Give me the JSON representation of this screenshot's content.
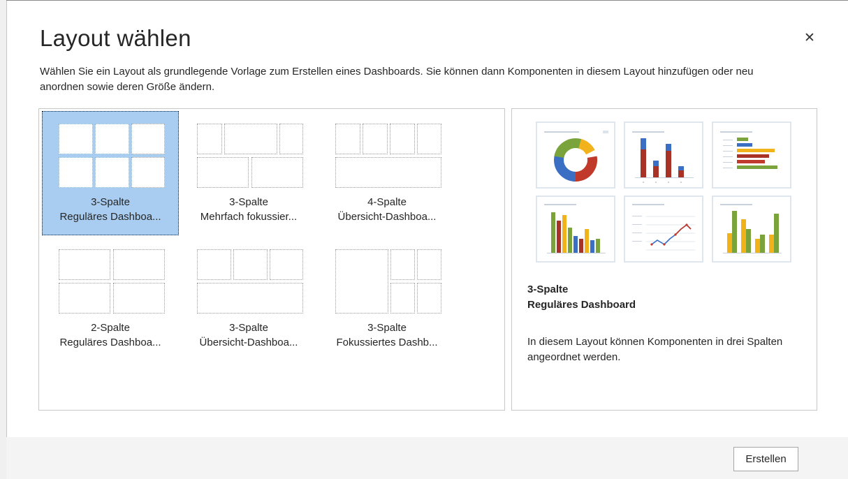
{
  "dialog": {
    "title": "Layout wählen",
    "close_glyph": "✕",
    "description": "Wählen Sie ein Layout als grundlegende Vorlage zum Erstellen eines Dashboards. Sie können dann Komponenten in diesem Layout hinzufügen oder neu anordnen sowie deren Größe ändern."
  },
  "layouts": [
    {
      "line1": "3-Spalte",
      "line2": "Reguläres Dashboa...",
      "selected": true
    },
    {
      "line1": "3-Spalte",
      "line2": "Mehrfach fokussier...",
      "selected": false
    },
    {
      "line1": "4-Spalte",
      "line2": "Übersicht-Dashboa...",
      "selected": false
    },
    {
      "line1": "2-Spalte",
      "line2": "Reguläres Dashboa...",
      "selected": false
    },
    {
      "line1": "3-Spalte",
      "line2": "Übersicht-Dashboa...",
      "selected": false
    },
    {
      "line1": "3-Spalte",
      "line2": "Fokussiertes Dashb...",
      "selected": false
    }
  ],
  "preview": {
    "name_line1": "3-Spalte",
    "name_line2": "Reguläres Dashboard",
    "description": "In diesem Layout können Komponenten in drei Spalten angeordnet werden.",
    "thumbnails": [
      {
        "kind": "donut-chart"
      },
      {
        "kind": "stacked-bar-chart"
      },
      {
        "kind": "horizontal-bar-chart"
      },
      {
        "kind": "grouped-bar-chart"
      },
      {
        "kind": "line-chart"
      },
      {
        "kind": "stacked-bar-chart"
      }
    ]
  },
  "footer": {
    "create_label": "Erstellen"
  },
  "colors": {
    "selection": "#a9cdf1",
    "red": "#c0392b",
    "blue": "#3b6fc4",
    "green": "#7aa33c",
    "yellow": "#f2b21b"
  }
}
